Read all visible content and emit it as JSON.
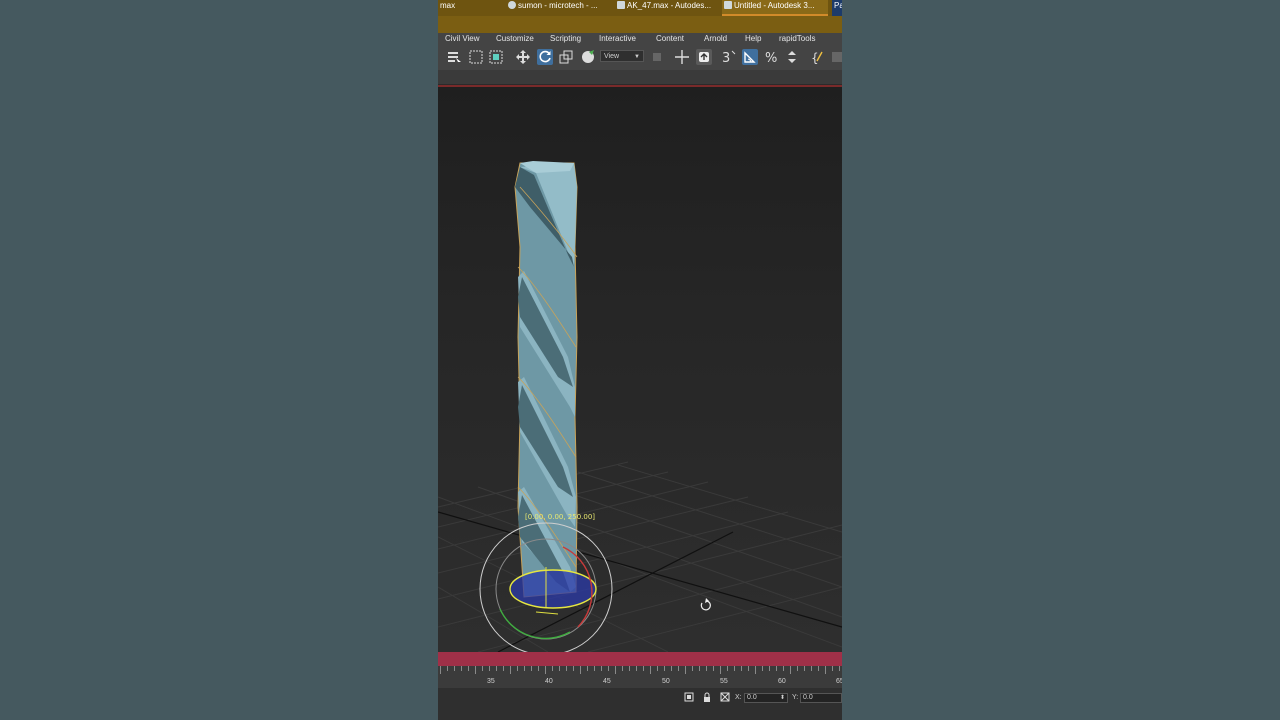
{
  "taskbar": {
    "items": [
      {
        "label": "max"
      },
      {
        "label": "sumon - microtech - ..."
      },
      {
        "label": "AK_47.max - Autodes..."
      },
      {
        "label": "Untitled - Autodesk 3..."
      },
      {
        "label": "Pa"
      }
    ]
  },
  "menu": {
    "items": [
      {
        "label": "Civil View"
      },
      {
        "label": "Customize"
      },
      {
        "label": "Scripting"
      },
      {
        "label": "Interactive"
      },
      {
        "label": "Content"
      },
      {
        "label": "Arnold"
      },
      {
        "label": "Help"
      },
      {
        "label": "rapidTools"
      }
    ]
  },
  "toolbar": {
    "view_dropdown": "View",
    "icons": [
      "select-object-icon",
      "rectangle-select-icon",
      "window-crossing-icon",
      "move-icon",
      "rotate-icon",
      "scale-icon",
      "place-icon",
      "select-manipulate-icon",
      "keyboard-shortcut-icon",
      "angle-snap-icon",
      "snaps-toggle-icon",
      "percent-snap-icon",
      "spinner-snap-icon",
      "edit-named-selection-icon"
    ],
    "accent": "#3f6f9e"
  },
  "viewport": {
    "gizmo_readout": "[0.00, 0.00, 250.00]",
    "object_color": "#7fa7b3"
  },
  "timeline": {
    "ticks": [
      "35",
      "40",
      "45",
      "50",
      "55",
      "60",
      "65"
    ]
  },
  "status": {
    "x_label": "X:",
    "x_value": "0.0",
    "y_label": "Y:",
    "y_value": "0.0"
  }
}
